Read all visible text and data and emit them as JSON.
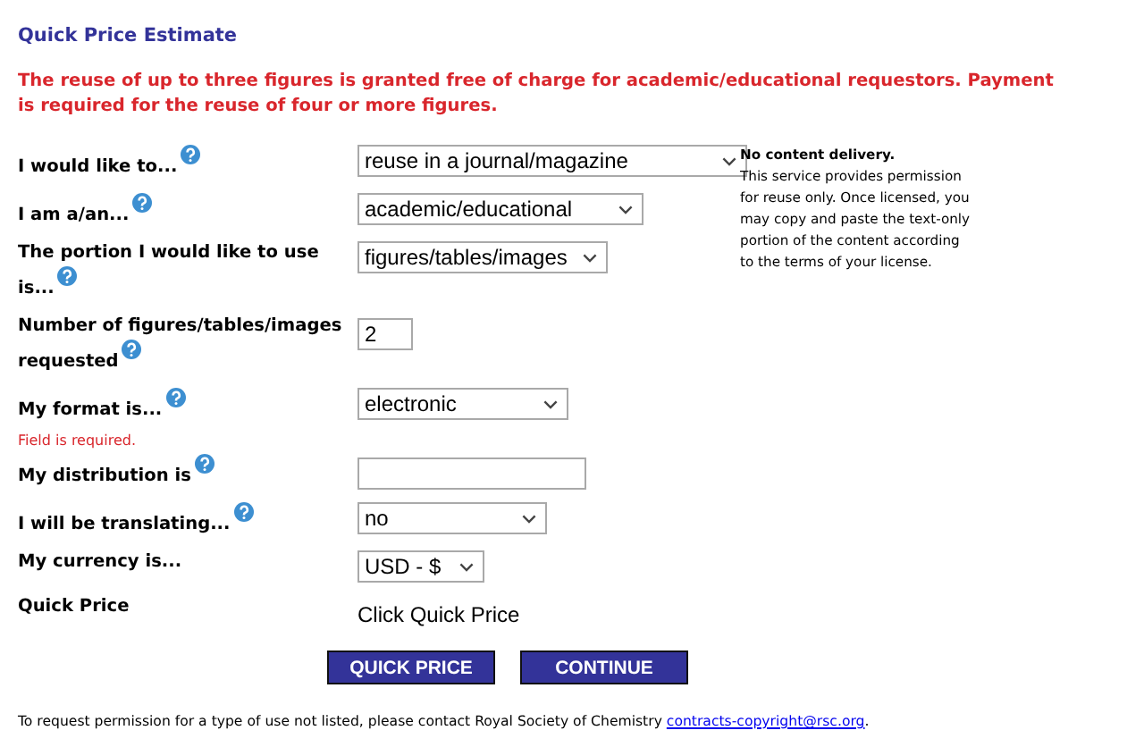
{
  "title": "Quick Price Estimate",
  "notice": "The reuse of up to three figures is granted free of charge for academic/educational requestors. Payment is required for the reuse of four or more figures.",
  "fields": [
    {
      "kind": "select",
      "label": "I would like to...",
      "help": true,
      "value": "reuse in a journal/magazine"
    },
    {
      "kind": "select",
      "label": "I am a/an...",
      "help": true,
      "value": "academic/educational"
    },
    {
      "kind": "select",
      "label": "The portion I would like to use is...",
      "help": true,
      "value": "figures/tables/images"
    },
    {
      "kind": "input",
      "label": "Number of figures/tables/images requested",
      "help": true,
      "value": "2"
    },
    {
      "kind": "select",
      "label": "My format is...",
      "help": true,
      "value": "electronic"
    },
    {
      "kind": "input",
      "label": "My distribution is",
      "help": true,
      "error": "Field is required."
    },
    {
      "kind": "select",
      "label": "I will be translating...",
      "help": true,
      "value": "no"
    },
    {
      "kind": "select",
      "label": "My currency is...",
      "help": false,
      "value": "USD - $"
    },
    {
      "kind": "text",
      "label": "Quick Price",
      "help": false,
      "value": "Click Quick Price"
    }
  ],
  "note": {
    "heading": "No content delivery.",
    "body": "This service provides permission for reuse only. Once licensed, you may copy and paste the text-only portion of the content according to the terms of your license."
  },
  "buttons": [
    "QUICK PRICE",
    "CONTINUE"
  ],
  "footer": {
    "text": "To request permission for a type of use not listed, please contact Royal Society of Chemistry",
    "link": "contracts-copyright@rsc.org",
    "tail": "."
  }
}
